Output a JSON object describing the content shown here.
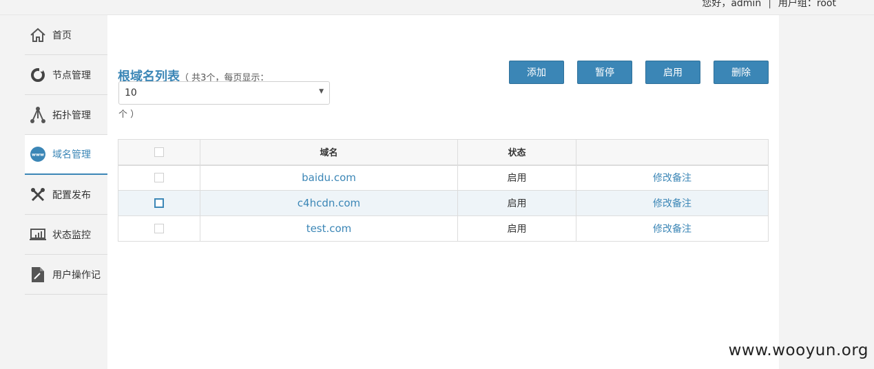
{
  "header": {
    "greeting": "您好，admin",
    "separator": "|",
    "usergroup": "用户组：root"
  },
  "sidebar": {
    "items": [
      {
        "label": "首页",
        "icon": "home-icon"
      },
      {
        "label": "节点管理",
        "icon": "ring-icon"
      },
      {
        "label": "拓扑管理",
        "icon": "topology-icon"
      },
      {
        "label": "域名管理",
        "icon": "www-icon",
        "active": true
      },
      {
        "label": "配置发布",
        "icon": "tools-icon"
      },
      {
        "label": "状态监控",
        "icon": "monitor-icon"
      },
      {
        "label": "用户操作记",
        "icon": "document-edit-icon"
      }
    ]
  },
  "main": {
    "title": "根域名列表",
    "title_note": "（ 共3个，每页显示：",
    "page_size": "10",
    "title_end": "个 ）",
    "buttons": {
      "add": "添加",
      "pause": "暂停",
      "enable": "启用",
      "delete": "删除"
    },
    "table": {
      "headers": [
        "",
        "域名",
        "状态",
        ""
      ],
      "rows": [
        {
          "domain": "baidu.com",
          "status": "启用",
          "action": "修改备注"
        },
        {
          "domain": "c4hcdn.com",
          "status": "启用",
          "action": "修改备注"
        },
        {
          "domain": "test.com",
          "status": "启用",
          "action": "修改备注"
        }
      ]
    }
  },
  "watermark": "www.wooyun.org",
  "colors": {
    "accent": "#3b86b6",
    "background": "#f3f3f3",
    "row_highlight": "#eef4f8"
  }
}
